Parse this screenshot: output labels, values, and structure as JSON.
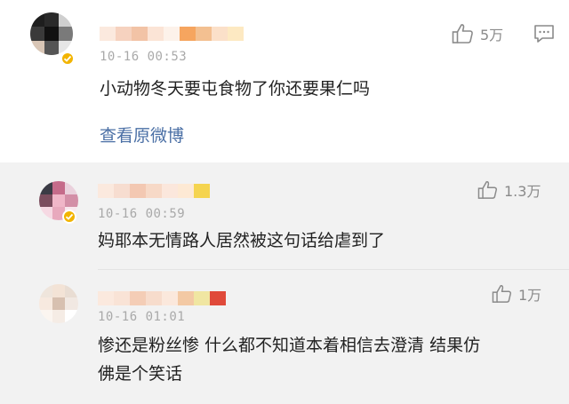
{
  "main_comment": {
    "timestamp": "10-16 00:53",
    "text": "小动物冬天要屯食物了你还要果仁吗",
    "like_count": "5万",
    "view_original_label": "查看原微博"
  },
  "replies": [
    {
      "timestamp": "10-16 00:59",
      "text": "妈耶本无情路人居然被这句话给虐到了",
      "like_count": "1.3万"
    },
    {
      "timestamp": "10-16 01:01",
      "text_line1": "惨还是粉丝惨 什么都不知道本着相信去澄清 结果仿",
      "text_line2": "佛是个笑话",
      "like_count": "1万"
    }
  ],
  "icons": {
    "like": "thumbs-up-icon",
    "comment": "comment-icon",
    "verified": "verified-badge-icon"
  },
  "colors": {
    "link": "#4a6fa5",
    "timestamp": "#a9a9a9",
    "reply_background": "#f2f2f2",
    "verified_badge": "#f2b400"
  }
}
